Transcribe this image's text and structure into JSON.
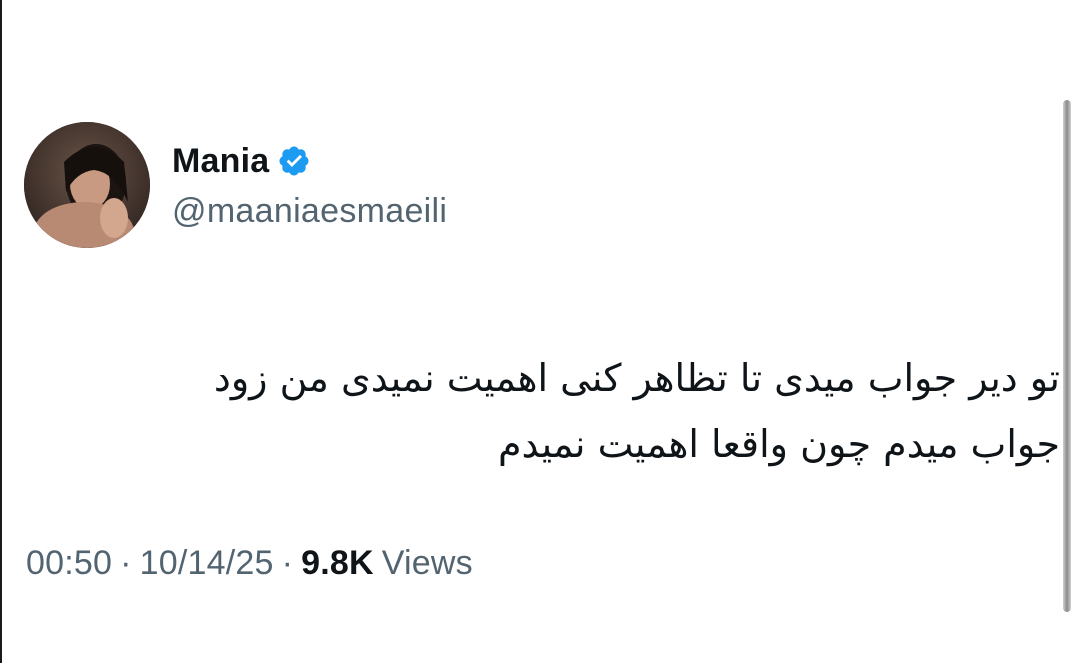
{
  "author": {
    "display_name": "Mania",
    "handle": "@maaniaesmaeili",
    "verified_icon": "verified-badge-icon",
    "verified_color": "#1d9bf0"
  },
  "tweet": {
    "lines": [
      "تو دیر جواب میدی تا تظاهر کنی اهمیت نمیدی من زود",
      "جواب میدم چون واقعا اهمیت نمیدم"
    ]
  },
  "meta": {
    "time": "00:50",
    "separator": "·",
    "date": "10/14/25",
    "views_count": "9.8K",
    "views_label": "Views"
  },
  "colors": {
    "text_primary": "#0f1419",
    "text_secondary": "#536471",
    "background": "#ffffff"
  }
}
